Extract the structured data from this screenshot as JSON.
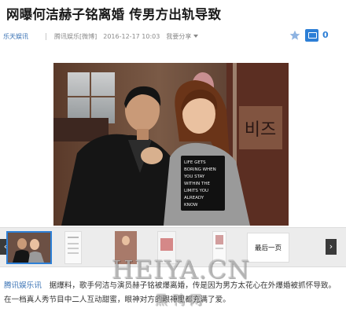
{
  "article": {
    "title": "网曝何洁赫子铭离婚 传男方出轨导致",
    "source": "乐天娱讯",
    "site": "腾讯娱乐[微博]",
    "datetime": "2016-12-17 10:03",
    "share_label": "我要分享",
    "comment_count": "0",
    "paragraph_source": "腾讯娱乐讯",
    "paragraph_text": "　据爆料，歌手何洁与演员赫子铭被爆离婚，传是因为男方太花心在外爆婚被抓怀导致。在一档真人秀节目中二人互动甜蜜，眼神对方的眼神里都充满了爱。"
  },
  "gallery": {
    "last_page_label": "最后一页",
    "prev_label": "‹",
    "next_label": "›"
  },
  "photo": {
    "shirt_lines": [
      "LIFE GETS",
      "BORING WHEN",
      "YOU STAY",
      "WITHIN THE",
      "LIMITS YOU",
      "ALREADY",
      "KNOW"
    ],
    "wall_sign": "비즈"
  },
  "watermark": {
    "main": "HEIYA.CN",
    "sub": "黑鸭网"
  },
  "colors": {
    "accent": "#2d7fd6",
    "link": "#3a72b4"
  }
}
